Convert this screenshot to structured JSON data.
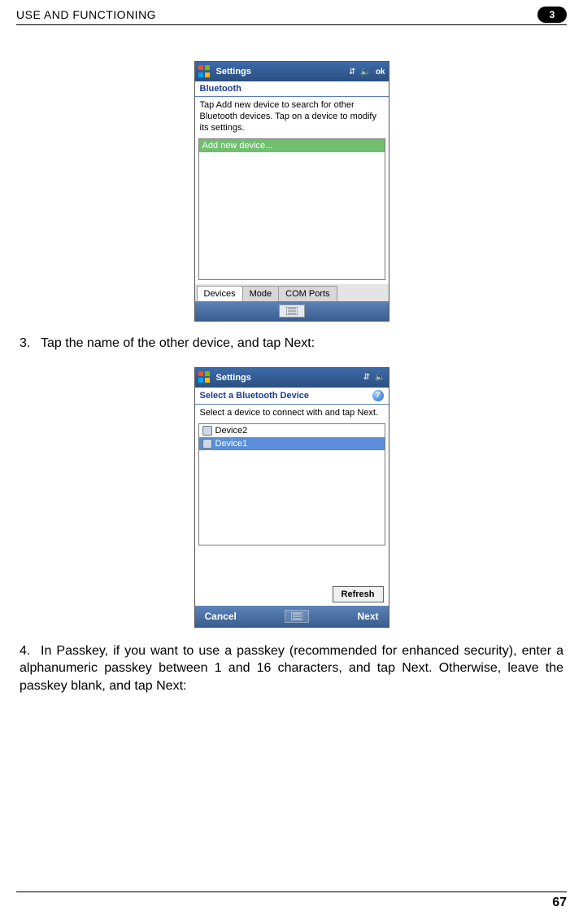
{
  "header": {
    "title": "USE AND FUNCTIONING",
    "chapter": "3"
  },
  "screenshot1": {
    "titlebar": "Settings",
    "ok": "ok",
    "subtitle": "Bluetooth",
    "instruction": "Tap Add new device to search for other Bluetooth devices. Tap on a device to modify its settings.",
    "list": {
      "item0": "Add new device..."
    },
    "tabs": {
      "t0": "Devices",
      "t1": "Mode",
      "t2": "COM Ports"
    }
  },
  "step3": {
    "num": "3.",
    "text": "Tap the name of the other device, and tap Next:"
  },
  "screenshot2": {
    "titlebar": "Settings",
    "subtitle": "Select a Bluetooth Device",
    "help": "?",
    "instruction": "Select a device to connect with and tap Next.",
    "list": {
      "item0": "Device2",
      "item1": "Device1"
    },
    "refresh": "Refresh",
    "cancel": "Cancel",
    "next": "Next"
  },
  "step4": {
    "num": "4.",
    "text": "In Passkey, if you want to use a passkey (recommended for enhanced security), enter a alphanumeric passkey between 1 and 16 characters, and tap Next. Otherwise, leave the passkey blank, and tap Next:"
  },
  "footer": {
    "page": "67"
  }
}
